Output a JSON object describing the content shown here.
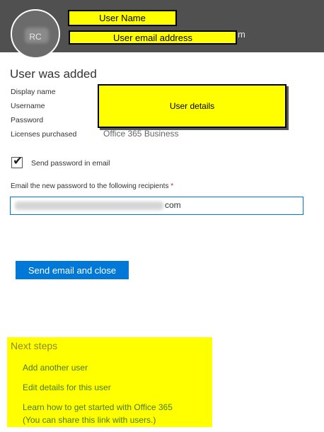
{
  "header": {
    "avatar_initials": "RC",
    "user_name_box": "User Name",
    "user_email_box": "User email address",
    "email_tail": "m"
  },
  "main": {
    "title": "User was added",
    "labels": {
      "display_name": "Display name",
      "username": "Username",
      "password": "Password",
      "licenses": "Licenses purchased"
    },
    "details_box": "User details",
    "license_value": "Office 365 Business",
    "send_password_checkbox": {
      "label": "Send password in email",
      "checked": true
    },
    "recipients": {
      "label": "Email the new password to the following recipients",
      "required_mark": "*",
      "value_tail": "com"
    },
    "send_button": "Send email and close"
  },
  "next_steps": {
    "title": "Next steps",
    "links": [
      "Add another user",
      "Edit details for this user",
      "Learn how to get started with Office 365"
    ],
    "note": "(You can share this link with users.)"
  },
  "colors": {
    "header_bg": "#505050",
    "accent": "#0078d7",
    "highlight": "#ffff00",
    "link_green": "#4a7a1a",
    "required_red": "#c4262e"
  },
  "icons": {
    "checkbox": "checkmark-icon"
  }
}
